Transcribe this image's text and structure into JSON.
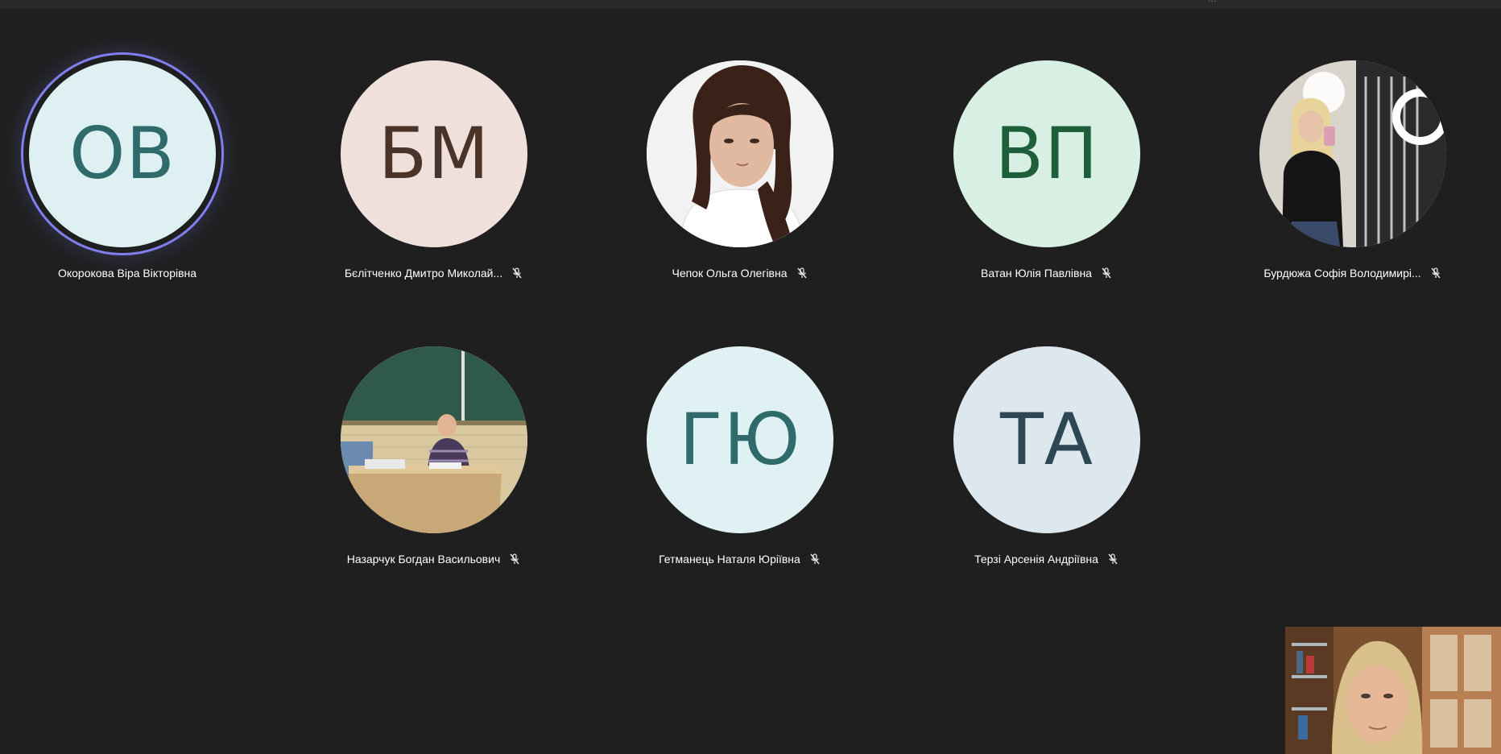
{
  "meeting": {
    "top_bar_fragment": "…"
  },
  "participants": [
    {
      "name": "Окорокова Віра Вікторівна",
      "initials": "ОВ",
      "avatar_bg": "#dff0f3",
      "initials_color": "#2f6b6b",
      "speaking": true,
      "muted": false,
      "photo": null
    },
    {
      "name": "Бєлітченко Дмитро Миколай...",
      "initials": "БМ",
      "avatar_bg": "#efe0dc",
      "initials_color": "#4a3328",
      "speaking": false,
      "muted": true,
      "photo": null
    },
    {
      "name": "Чепок Ольга Олегівна",
      "initials": "",
      "avatar_bg": "#eeeeee",
      "initials_color": "#333333",
      "speaking": false,
      "muted": true,
      "photo": "portrait-woman-dark-hair"
    },
    {
      "name": "Ватан Юлія Павлівна",
      "initials": "ВП",
      "avatar_bg": "#d8f0e3",
      "initials_color": "#1f5e3a",
      "speaking": false,
      "muted": true,
      "photo": null
    },
    {
      "name": "Бурдюжа Софія Володимирі...",
      "initials": "",
      "avatar_bg": "#2a2a2a",
      "initials_color": "#ffffff",
      "speaking": false,
      "muted": true,
      "photo": "mirror-selfie-woman-blonde"
    },
    {
      "name": "Назарчук Богдан Васильович",
      "initials": "",
      "avatar_bg": "#c9b38a",
      "initials_color": "#333333",
      "speaking": false,
      "muted": true,
      "photo": "classroom-man-at-desk"
    },
    {
      "name": "Гетманець Наталя Юріївна",
      "initials": "ГЮ",
      "avatar_bg": "#dff1f2",
      "initials_color": "#2f6b6b",
      "speaking": false,
      "muted": true,
      "photo": null
    },
    {
      "name": "Терзі Арсенія Андріївна",
      "initials": "ТА",
      "avatar_bg": "#dde7ee",
      "initials_color": "#2d4753",
      "speaking": false,
      "muted": true,
      "photo": null
    }
  ],
  "self_view": {
    "photo": "webcam-woman-blonde"
  },
  "icons": {
    "muted": "mic-off-icon"
  },
  "colors": {
    "stage_bg": "#1f1f1f",
    "speaking_ring": "#7f7ff0",
    "name_text": "#ffffff"
  }
}
